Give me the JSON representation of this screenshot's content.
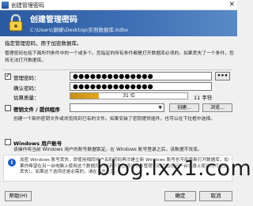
{
  "window": {
    "title": "创建管理密码",
    "close_glyph": "✕"
  },
  "banner": {
    "heading": "创建管理密码",
    "path": "C:\\Users\\谢婕\\Desktop\\实例数据库.kdbx"
  },
  "intro": {
    "line1": "指定管理密码，用于加密数据库。",
    "line2": "管理密码包括下面所列条件中的一个或多个。您指定的所有条件都是打开数据库必须的。如果丢失了一个条件，您将无法打开数据库。"
  },
  "master_password": {
    "checkbox_label": "管理密码：",
    "checked": true,
    "value": "●●●●●●●●●●●●●●",
    "toggle_label": "•••"
  },
  "repeat_password": {
    "label": "确认密码：",
    "value": "●●●●●●●●●●●●●●"
  },
  "quality": {
    "label": "估算质量：",
    "bits_text": "31 位",
    "chars_text": "11 字符",
    "fill_percent": 24
  },
  "key_file": {
    "checkbox_label": "密钥文件 / 提供程序",
    "checked": false,
    "create_label": "创建...",
    "browse_label": "浏览...",
    "description": "创建一个新的密钥文件或浏览找到已有的文件。如果安装了密钥提供插件，也可以在下拉框中选择。"
  },
  "windows_account": {
    "checkbox_label": "Windows 用户账号",
    "checked": false,
    "description": "该操作将当前 Windows 用户的账号数据锁定。在 Windows 账号登录之后，该数据不改变。"
  },
  "warning": {
    "icon": "i",
    "text": "加密 Windows 账号丢失，即使用相同用户名和密码再次建立新 Windows 账号也不能重新打开数据库。如果你希望在另一台电脑上使用这个数据库，则请不要选择此项（管理密码功能在另一台机器上使用时可能会丢失）。如果这个选项还是必需的，请在丢失之后..."
  },
  "footer": {
    "help_label": "帮助(H)",
    "ok_label": "确定",
    "cancel_label": "取消"
  },
  "watermark": "blog.lxx1.com",
  "colors": {
    "banner": "#2c5aa0",
    "quality_fill": "#e3a51f",
    "accent": "#1d5fc0"
  }
}
